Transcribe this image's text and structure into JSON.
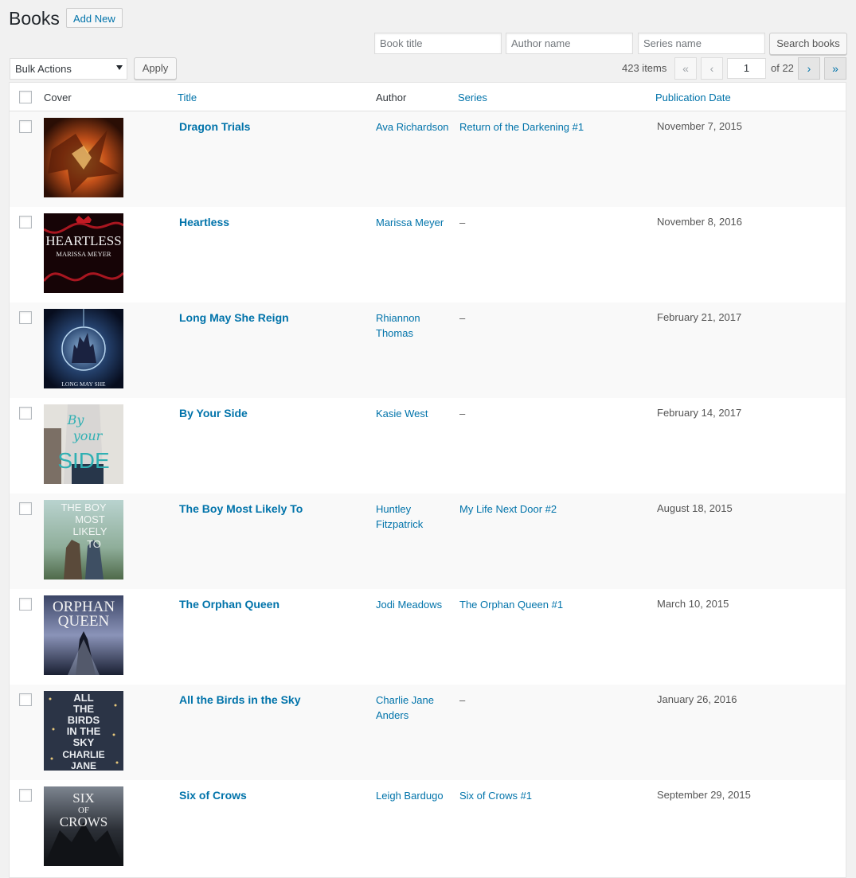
{
  "header": {
    "title": "Books",
    "add_new": "Add New"
  },
  "search": {
    "book_title_placeholder": "Book title",
    "author_placeholder": "Author name",
    "series_placeholder": "Series name",
    "button": "Search books"
  },
  "bulk": {
    "selected": "Bulk Actions",
    "apply": "Apply"
  },
  "pagination": {
    "items": "423 items",
    "first": "«",
    "prev": "‹",
    "current": "1",
    "of": "of 22",
    "next": "›",
    "last": "»"
  },
  "table": {
    "columns": {
      "cover": "Cover",
      "title": "Title",
      "author": "Author",
      "series": "Series",
      "date": "Publication Date"
    },
    "rows": [
      {
        "title": "Dragon Trials",
        "author": "Ava Richardson",
        "series": "Return of the Darkening #1",
        "date": "November 7, 2015"
      },
      {
        "title": "Heartless",
        "author": "Marissa Meyer",
        "series": "–",
        "date": "November 8, 2016"
      },
      {
        "title": "Long May She Reign",
        "author": "Rhiannon Thomas",
        "series": "–",
        "date": "February 21, 2017"
      },
      {
        "title": "By Your Side",
        "author": "Kasie West",
        "series": "–",
        "date": "February 14, 2017"
      },
      {
        "title": "The Boy Most Likely To",
        "author": "Huntley Fitzpatrick",
        "series": "My Life Next Door #2",
        "date": "August 18, 2015"
      },
      {
        "title": "The Orphan Queen",
        "author": "Jodi Meadows",
        "series": "The Orphan Queen #1",
        "date": "March 10, 2015"
      },
      {
        "title": "All the Birds in the Sky",
        "author": "Charlie Jane Anders",
        "series": "–",
        "date": "January 26, 2016"
      },
      {
        "title": "Six of Crows",
        "author": "Leigh Bardugo",
        "series": "Six of Crows #1",
        "date": "September 29, 2015"
      }
    ]
  },
  "covers": {
    "c2_title": "HEARTLESS",
    "c2_author": "MARISSA MEYER",
    "c3_text": "LONG MAY SHE",
    "c4_l1": "By",
    "c4_l2": "your",
    "c4_l3": "SIDE",
    "c5_l1": "THE BOY",
    "c5_l2": "MOST",
    "c5_l3": "LIKELY",
    "c5_l4": "TO",
    "c6_l1": "ORPHAN",
    "c6_l2": "QUEEN",
    "c7_l1": "ALL",
    "c7_l2": "THE",
    "c7_l3": "BIRDS",
    "c7_l4": "IN THE",
    "c7_l5": "SKY",
    "c7_l6": "CHARLIE",
    "c7_l7": "JANE",
    "c8_l1": "SIX",
    "c8_l2": "OF",
    "c8_l3": "CROWS"
  }
}
